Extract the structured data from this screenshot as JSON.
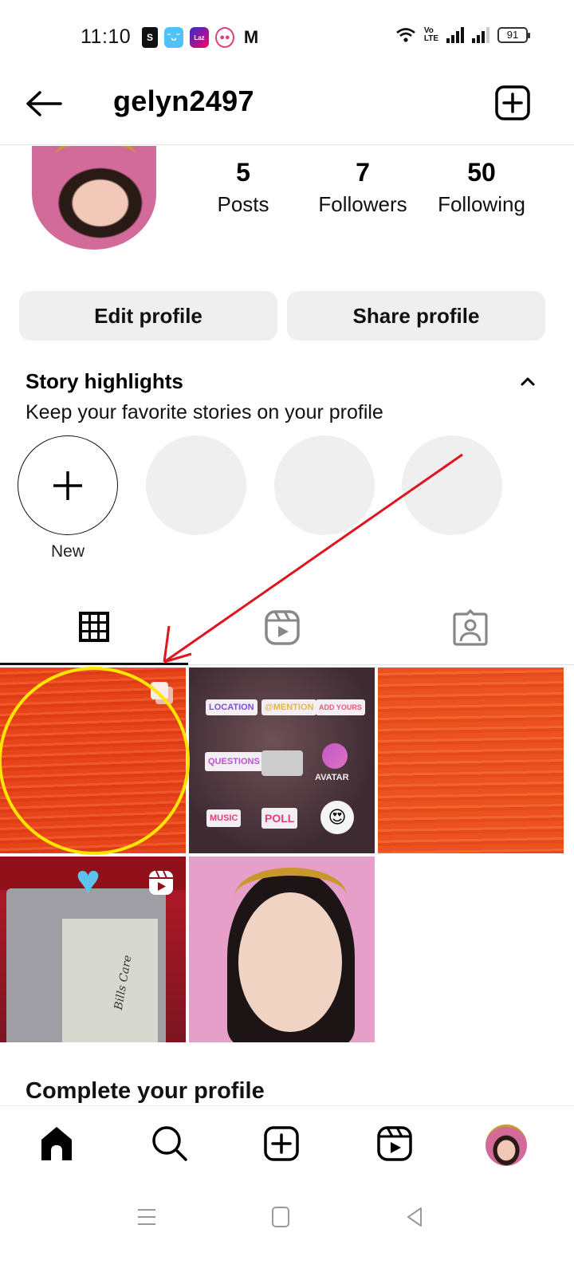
{
  "status_bar": {
    "time": "11:10",
    "notification_icons": [
      "shopee-icon",
      "bilibili-icon",
      "lazada-icon",
      "foodpanda-icon",
      "gmail-icon"
    ],
    "notif_labels": {
      "shopee": "S",
      "lazada": "Laz",
      "gmail": "M"
    },
    "volte": "Vo\nLTE",
    "battery": "91"
  },
  "header": {
    "username": "gelyn2497"
  },
  "profile": {
    "stats": [
      {
        "count": "5",
        "label": "Posts"
      },
      {
        "count": "7",
        "label": "Followers"
      },
      {
        "count": "50",
        "label": "Following"
      }
    ],
    "edit_profile_label": "Edit profile",
    "share_profile_label": "Share profile"
  },
  "highlights": {
    "title": "Story highlights",
    "subtitle": "Keep your favorite stories on your profile",
    "new_label": "New",
    "placeholder_count": 3
  },
  "content_tabs": [
    {
      "name": "posts-grid",
      "active": true
    },
    {
      "name": "reels",
      "active": false
    },
    {
      "name": "tagged",
      "active": false
    }
  ],
  "posts": [
    {
      "type": "carousel",
      "description": "orange wood texture"
    },
    {
      "type": "image",
      "description": "story stickers",
      "stickers": {
        "location": "LOCATION",
        "mention": "@MENTION",
        "add_yours": "ADD YOURS",
        "questions": "QUESTIONS",
        "avatar": "AVATAR",
        "music": "MUSIC",
        "poll": "POLL",
        "emoji": "😍"
      }
    },
    {
      "type": "image",
      "description": "orange wood texture"
    },
    {
      "type": "reel",
      "description": "planner binder",
      "text": "Bills Care"
    },
    {
      "type": "image",
      "description": "selfie"
    }
  ],
  "complete_profile": {
    "title": "Complete your profile"
  },
  "bottom_nav": [
    "home",
    "search",
    "create",
    "reels",
    "profile"
  ],
  "annotations": {
    "arrow_color": "#e0141e",
    "circle_color": "#ffe600"
  }
}
